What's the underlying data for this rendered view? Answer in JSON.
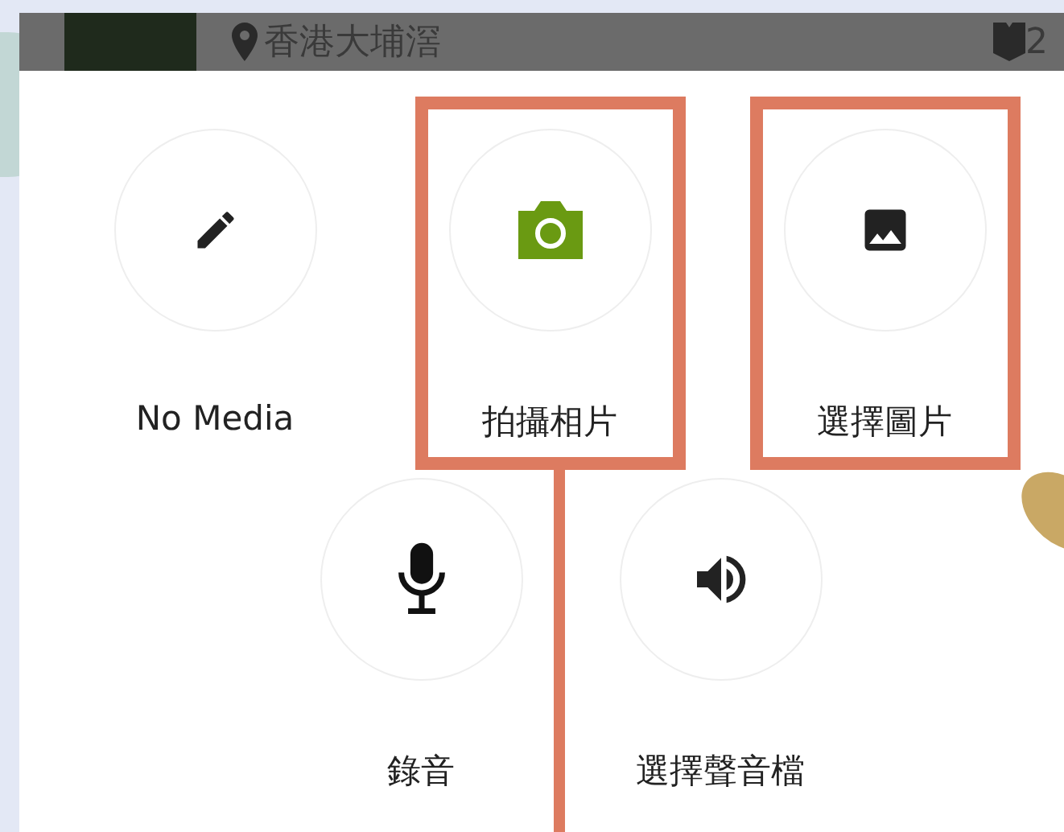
{
  "top_bar": {
    "location": "香港大埔滘",
    "count": "2"
  },
  "options": [
    {
      "kind": "pencil",
      "label": "No Media",
      "highlighted": false
    },
    {
      "kind": "camera",
      "label": "拍攝相片",
      "highlighted": true
    },
    {
      "kind": "image",
      "label": "選擇圖片",
      "highlighted": true
    },
    {
      "kind": "mic",
      "label": "錄音",
      "highlighted": false
    },
    {
      "kind": "speaker",
      "label": "選擇聲音檔",
      "highlighted": false
    }
  ]
}
